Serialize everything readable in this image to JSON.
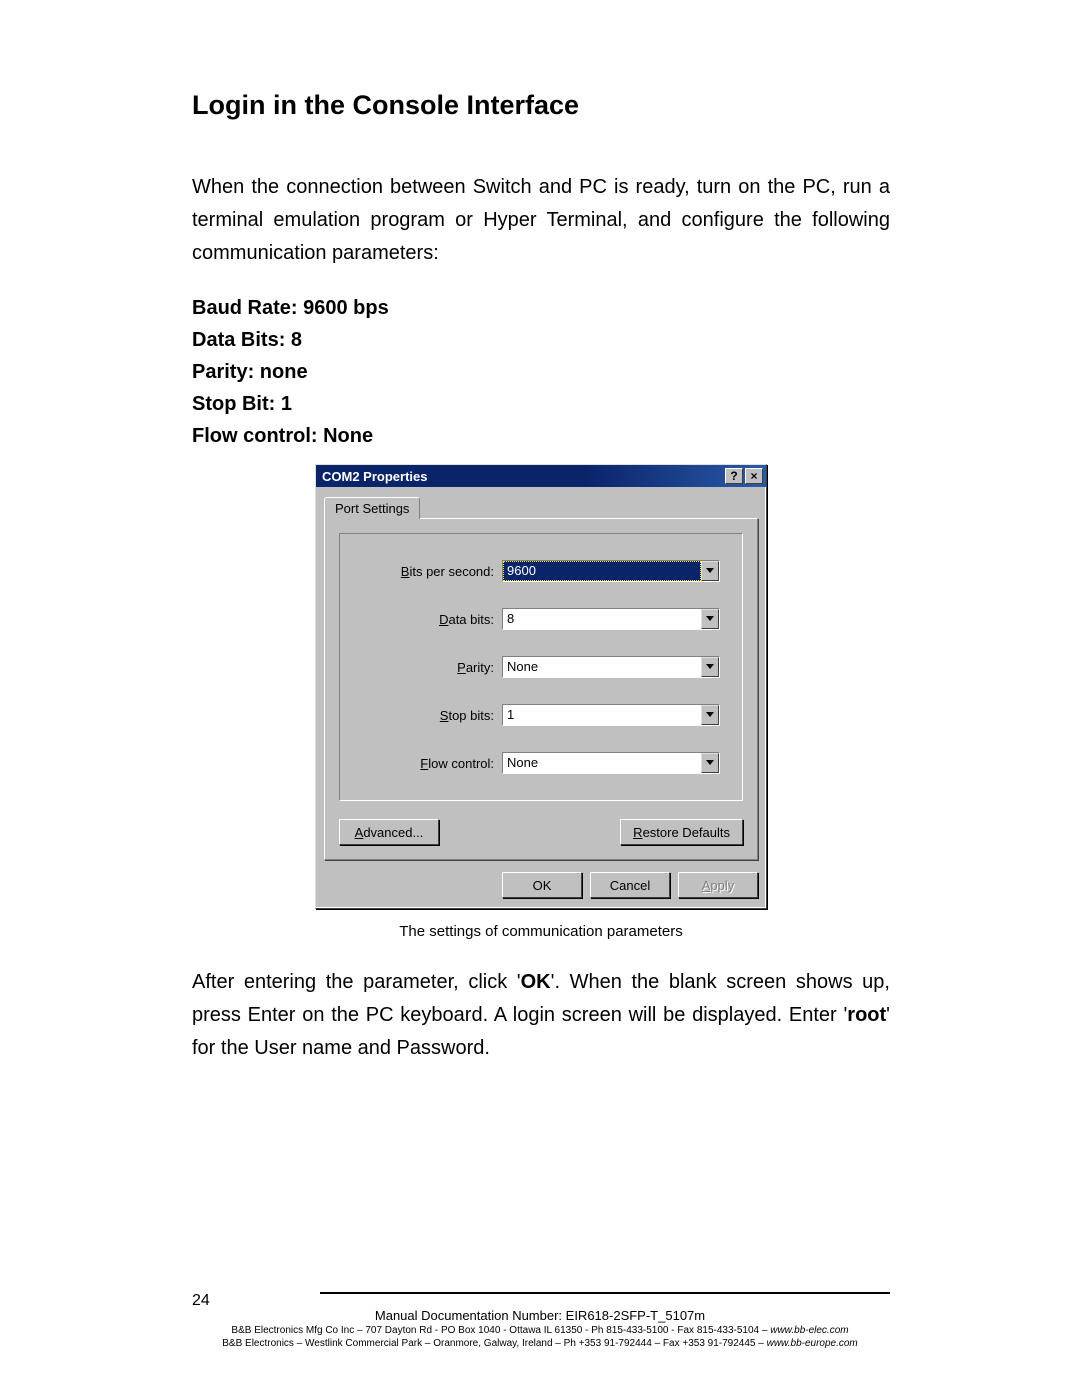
{
  "heading": "Login in the Console Interface",
  "intro": "When the connection between Switch and PC is ready, turn on the PC, run a terminal emulation program or Hyper Terminal, and configure the following communication parameters:",
  "params": {
    "baud": "Baud Rate: 9600 bps",
    "databits": "Data Bits: 8",
    "parity": "Parity: none",
    "stopbit": "Stop Bit: 1",
    "flow": "Flow control: None"
  },
  "dialog": {
    "title": "COM2 Properties",
    "help_icon": "?",
    "close_icon": "×",
    "tab": "Port Settings",
    "rows": {
      "bps": {
        "label_pre": "B",
        "label_rest": "its per second:",
        "value": "9600"
      },
      "data": {
        "label_pre": "D",
        "label_rest": "ata bits:",
        "value": "8"
      },
      "parity": {
        "label_pre": "P",
        "label_rest": "arity:",
        "value": "None"
      },
      "stop": {
        "label_pre": "S",
        "label_rest": "top bits:",
        "value": "1"
      },
      "flow": {
        "label_pre": "F",
        "label_rest": "low control:",
        "value": "None"
      }
    },
    "advanced": "Advanced...",
    "restore": "Restore Defaults",
    "ok": "OK",
    "cancel": "Cancel",
    "apply": "Apply"
  },
  "caption": "The settings of communication parameters",
  "outro_pre": "After entering the parameter, click '",
  "outro_ok": "OK",
  "outro_mid": "'. When the blank screen shows up, press Enter on the PC keyboard. A login screen will be displayed. Enter '",
  "outro_root": "root",
  "outro_post": "' for the User name and Password.",
  "footer": {
    "page": "24",
    "doc": "Manual Documentation Number: EIR618-2SFP-T_5107m",
    "line1_a": "B&B Electronics Mfg Co Inc – 707 Dayton Rd - PO Box 1040 - Ottawa IL 61350 - Ph 815-433-5100 - Fax 815-433-5104 – ",
    "line1_b": "www.bb-elec.com",
    "line2_a": "B&B Electronics – Westlink Commercial Park – Oranmore, Galway, Ireland – Ph +353 91-792444 – Fax +353 91-792445 – ",
    "line2_b": "www.bb-europe.com"
  }
}
